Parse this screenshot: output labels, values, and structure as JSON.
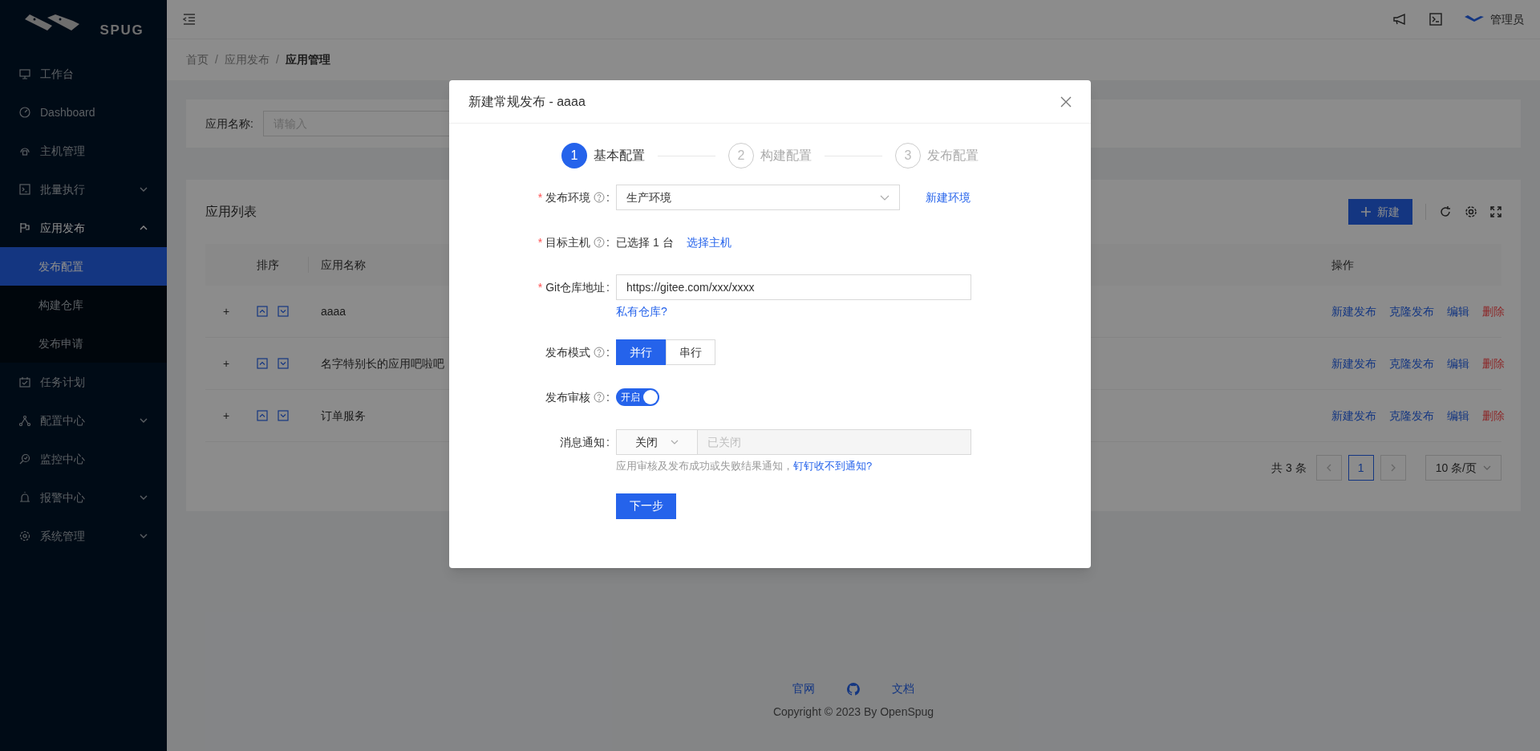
{
  "sidebar": {
    "logo_text": "SPUG",
    "items": [
      {
        "label": "工作台",
        "selected": false
      },
      {
        "label": "Dashboard",
        "selected": false
      },
      {
        "label": "主机管理",
        "selected": false
      },
      {
        "label": "批量执行",
        "selected": false,
        "expanded": false
      },
      {
        "label": "应用发布",
        "selected": false,
        "expanded": true,
        "children": [
          {
            "label": "发布配置",
            "selected": true
          },
          {
            "label": "构建仓库",
            "selected": false
          },
          {
            "label": "发布申请",
            "selected": false
          }
        ]
      },
      {
        "label": "任务计划",
        "selected": false
      },
      {
        "label": "配置中心",
        "selected": false,
        "expanded": false
      },
      {
        "label": "监控中心",
        "selected": false
      },
      {
        "label": "报警中心",
        "selected": false,
        "expanded": false
      },
      {
        "label": "系统管理",
        "selected": false,
        "expanded": false
      }
    ]
  },
  "header": {
    "user": "管理员"
  },
  "breadcrumb": {
    "separator": "/",
    "items": [
      "首页",
      "应用发布",
      "应用管理"
    ]
  },
  "search": {
    "label": "应用名称:",
    "placeholder": "请输入"
  },
  "table": {
    "title": "应用列表",
    "new_button": "新建",
    "columns": [
      "排序",
      "应用名称",
      "操作"
    ],
    "rows": [
      {
        "expand": "+",
        "name": "aaaa",
        "actions": [
          "新建发布",
          "克隆发布",
          "编辑",
          "删除"
        ]
      },
      {
        "expand": "+",
        "name": "名字特别长的应用吧啦吧",
        "actions": [
          "新建发布",
          "克隆发布",
          "编辑",
          "删除"
        ]
      },
      {
        "expand": "+",
        "name": "订单服务",
        "actions": [
          "新建发布",
          "克隆发布",
          "编辑",
          "删除"
        ]
      }
    ]
  },
  "pagination": {
    "total": "共 3 条",
    "pages": [
      {
        "label": "1",
        "selected": true
      }
    ],
    "page_size": "10 条/页"
  },
  "footer": {
    "links": [
      "官网",
      "文档"
    ],
    "copyright": "Copyright © 2023 By OpenSpug"
  },
  "modal": {
    "title": "新建常规发布 - aaaa",
    "steps": [
      {
        "number": "1",
        "label": "基本配置",
        "selected": true
      },
      {
        "number": "2",
        "label": "构建配置",
        "selected": false
      },
      {
        "number": "3",
        "label": "发布配置",
        "selected": false
      }
    ],
    "fields": [
      {
        "kind": "select",
        "label": "发布环境",
        "asterisk": "*",
        "help": true,
        "colon": ":",
        "value": "生产环境",
        "link": "新建环境"
      },
      {
        "kind": "text",
        "label": "目标主机",
        "asterisk": "*",
        "help": true,
        "colon": ":",
        "value": "已选择 1 台",
        "link": "选择主机"
      },
      {
        "kind": "input",
        "label": "Git仓库地址",
        "asterisk": "*",
        "help": false,
        "colon": ":",
        "value": "https://gitee.com/xxx/xxxx",
        "link": "私有仓库?"
      },
      {
        "kind": "radio",
        "label": "发布模式",
        "help": true,
        "colon": ":",
        "options": [
          {
            "label": "并行",
            "selected": true
          },
          {
            "label": "串行",
            "selected": false
          }
        ]
      },
      {
        "kind": "switch",
        "label": "发布审核",
        "help": true,
        "colon": ":",
        "on": true,
        "text": "开启"
      },
      {
        "kind": "addon",
        "label": "消息通知",
        "help": false,
        "colon": ":",
        "select": "关闭",
        "placeholder": "已关闭",
        "disabled": true,
        "hint": "应用审核及发布成功或失败结果通知，",
        "link": "钉钉收不到通知?"
      }
    ],
    "next_button": "下一步"
  }
}
